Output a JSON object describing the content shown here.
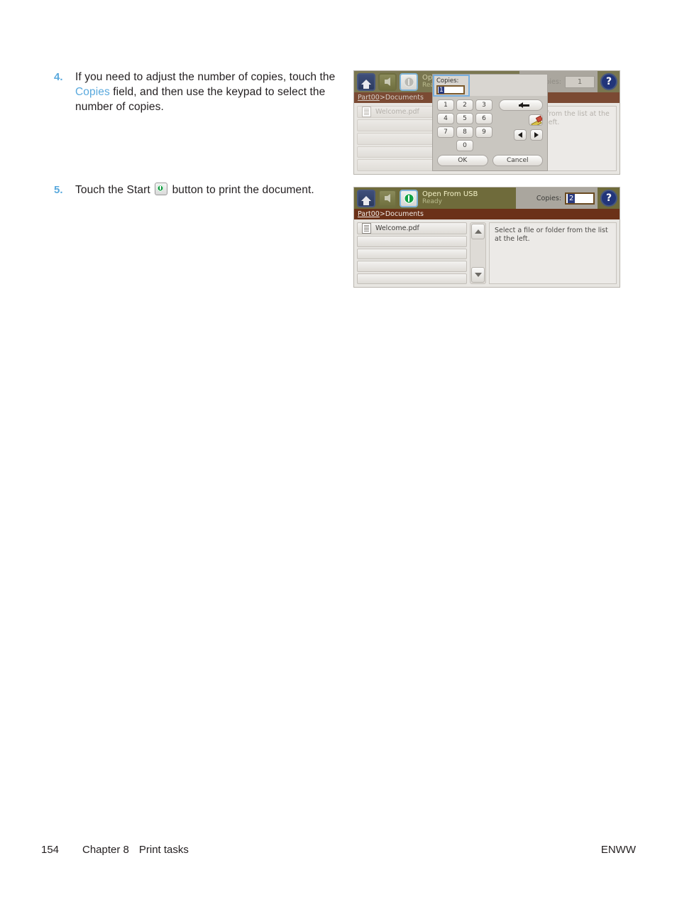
{
  "steps": [
    {
      "number": "4.",
      "text_pre": "If you need to adjust the number of copies, touch the ",
      "link": "Copies",
      "text_post": " field, and then use the keypad to select the number of copies."
    },
    {
      "number": "5.",
      "text_pre": "Touch the Start ",
      "icon": "start-icon",
      "text_post": " button to print the document."
    }
  ],
  "screenshot_keypad": {
    "toolbar": {
      "home_icon": "home-icon",
      "back_icon": "back-arrow-icon",
      "start_icon": "start-icon",
      "title": "Open From USB",
      "subtitle": "Ready",
      "copies_label": "Copies:",
      "copies_value": "1",
      "help_icon": "help-icon",
      "help_glyph": "?"
    },
    "breadcrumb": {
      "root": "Part00",
      "separator": ">",
      "current": "Documents"
    },
    "file_list": [
      {
        "name": "Welcome.pdf",
        "icon": "document-icon"
      },
      {
        "name": "",
        "icon": ""
      },
      {
        "name": "",
        "icon": ""
      },
      {
        "name": "",
        "icon": ""
      },
      {
        "name": "",
        "icon": ""
      }
    ],
    "detail_hint": "from the list at the left.",
    "dialog": {
      "field_label": "Copies:",
      "field_value": "1",
      "keys": [
        "1",
        "2",
        "3",
        "4",
        "5",
        "6",
        "7",
        "8",
        "9",
        "0"
      ],
      "backspace_icon": "backspace-arrow-icon",
      "erase_icon": "eraser-icon",
      "left_icon": "arrow-left-icon",
      "right_icon": "arrow-right-icon",
      "ok_label": "OK",
      "cancel_label": "Cancel"
    }
  },
  "screenshot_ready": {
    "toolbar": {
      "home_icon": "home-icon",
      "back_icon": "back-arrow-icon",
      "start_icon": "start-icon",
      "title": "Open From USB",
      "subtitle": "Ready",
      "copies_label": "Copies:",
      "copies_value": "2",
      "help_icon": "help-icon",
      "help_glyph": "?"
    },
    "breadcrumb": {
      "root": "Part00",
      "separator": ">",
      "current": "Documents"
    },
    "file_list": [
      {
        "name": "Welcome.pdf",
        "icon": "document-icon"
      },
      {
        "name": "",
        "icon": ""
      },
      {
        "name": "",
        "icon": ""
      },
      {
        "name": "",
        "icon": ""
      },
      {
        "name": "",
        "icon": ""
      }
    ],
    "scroll_up_icon": "chevron-up-icon",
    "scroll_down_icon": "chevron-down-icon",
    "detail_hint": "Select a file or folder from the list at the left."
  },
  "footer": {
    "page_number": "154",
    "chapter": "Chapter 8",
    "chapter_title": "Print tasks",
    "imprint": "ENWW"
  },
  "colors": {
    "accent_link": "#5aa9dd",
    "toolbar_olive": "#6f6b3b",
    "breadcrumb_brown": "#6b3118",
    "start_green": "#11a244",
    "help_blue": "#22357a"
  }
}
